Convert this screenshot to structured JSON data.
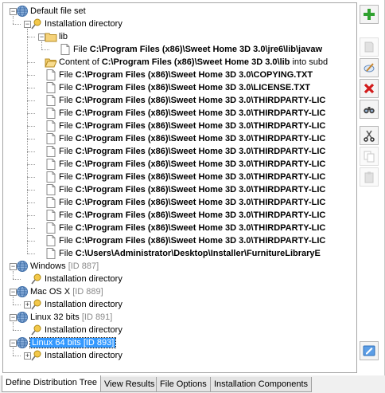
{
  "tree": {
    "rows": [
      {
        "id": "default-file-set",
        "level": 0,
        "toggle": "−",
        "icon": "globe-icon",
        "label": "Default file set",
        "label_bold": "",
        "label_suffix": "",
        "gray": "",
        "selected": false
      },
      {
        "id": "default-install-dir",
        "level": 1,
        "toggle": "−",
        "icon": "pin-icon",
        "label": "Installation directory",
        "label_bold": "",
        "label_suffix": "",
        "gray": "",
        "selected": false
      },
      {
        "id": "lib-folder",
        "level": 2,
        "toggle": "−",
        "icon": "folder-icon",
        "label": "lib",
        "label_bold": "",
        "label_suffix": "",
        "gray": "",
        "selected": false
      },
      {
        "id": "file-javaw",
        "level": 3,
        "toggle": "",
        "icon": "file-icon",
        "label": "File ",
        "label_bold": "C:\\Program Files (x86)\\Sweet Home 3D 3.0\\jre6\\lib\\javaw",
        "label_suffix": "",
        "gray": "",
        "selected": false
      },
      {
        "id": "content-of-lib",
        "level": 2,
        "toggle": "",
        "icon": "folder-open-icon",
        "label": "Content of ",
        "label_bold": "C:\\Program Files (x86)\\Sweet Home 3D 3.0\\lib",
        "label_suffix": " into subd",
        "gray": "",
        "selected": false
      },
      {
        "id": "file-copying",
        "level": 2,
        "toggle": "",
        "icon": "file-icon",
        "label": "File ",
        "label_bold": "C:\\Program Files (x86)\\Sweet Home 3D 3.0\\COPYING.TXT",
        "label_suffix": "",
        "gray": "",
        "selected": false
      },
      {
        "id": "file-license",
        "level": 2,
        "toggle": "",
        "icon": "file-icon",
        "label": "File ",
        "label_bold": "C:\\Program Files (x86)\\Sweet Home 3D 3.0\\LICENSE.TXT",
        "label_suffix": "",
        "gray": "",
        "selected": false
      },
      {
        "id": "file-thirdparty-1",
        "level": 2,
        "toggle": "",
        "icon": "file-icon",
        "label": "File ",
        "label_bold": "C:\\Program Files (x86)\\Sweet Home 3D 3.0\\THIRDPARTY-LIC",
        "label_suffix": "",
        "gray": "",
        "selected": false
      },
      {
        "id": "file-thirdparty-2",
        "level": 2,
        "toggle": "",
        "icon": "file-icon",
        "label": "File ",
        "label_bold": "C:\\Program Files (x86)\\Sweet Home 3D 3.0\\THIRDPARTY-LIC",
        "label_suffix": "",
        "gray": "",
        "selected": false
      },
      {
        "id": "file-thirdparty-3",
        "level": 2,
        "toggle": "",
        "icon": "file-icon",
        "label": "File ",
        "label_bold": "C:\\Program Files (x86)\\Sweet Home 3D 3.0\\THIRDPARTY-LIC",
        "label_suffix": "",
        "gray": "",
        "selected": false
      },
      {
        "id": "file-thirdparty-4",
        "level": 2,
        "toggle": "",
        "icon": "file-icon",
        "label": "File ",
        "label_bold": "C:\\Program Files (x86)\\Sweet Home 3D 3.0\\THIRDPARTY-LIC",
        "label_suffix": "",
        "gray": "",
        "selected": false
      },
      {
        "id": "file-thirdparty-5",
        "level": 2,
        "toggle": "",
        "icon": "file-icon",
        "label": "File ",
        "label_bold": "C:\\Program Files (x86)\\Sweet Home 3D 3.0\\THIRDPARTY-LIC",
        "label_suffix": "",
        "gray": "",
        "selected": false
      },
      {
        "id": "file-thirdparty-6",
        "level": 2,
        "toggle": "",
        "icon": "file-icon",
        "label": "File ",
        "label_bold": "C:\\Program Files (x86)\\Sweet Home 3D 3.0\\THIRDPARTY-LIC",
        "label_suffix": "",
        "gray": "",
        "selected": false
      },
      {
        "id": "file-thirdparty-7",
        "level": 2,
        "toggle": "",
        "icon": "file-icon",
        "label": "File ",
        "label_bold": "C:\\Program Files (x86)\\Sweet Home 3D 3.0\\THIRDPARTY-LIC",
        "label_suffix": "",
        "gray": "",
        "selected": false
      },
      {
        "id": "file-thirdparty-8",
        "level": 2,
        "toggle": "",
        "icon": "file-icon",
        "label": "File ",
        "label_bold": "C:\\Program Files (x86)\\Sweet Home 3D 3.0\\THIRDPARTY-LIC",
        "label_suffix": "",
        "gray": "",
        "selected": false
      },
      {
        "id": "file-thirdparty-9",
        "level": 2,
        "toggle": "",
        "icon": "file-icon",
        "label": "File ",
        "label_bold": "C:\\Program Files (x86)\\Sweet Home 3D 3.0\\THIRDPARTY-LIC",
        "label_suffix": "",
        "gray": "",
        "selected": false
      },
      {
        "id": "file-thirdparty-10",
        "level": 2,
        "toggle": "",
        "icon": "file-icon",
        "label": "File ",
        "label_bold": "C:\\Program Files (x86)\\Sweet Home 3D 3.0\\THIRDPARTY-LIC",
        "label_suffix": "",
        "gray": "",
        "selected": false
      },
      {
        "id": "file-thirdparty-11",
        "level": 2,
        "toggle": "",
        "icon": "file-icon",
        "label": "File ",
        "label_bold": "C:\\Program Files (x86)\\Sweet Home 3D 3.0\\THIRDPARTY-LIC",
        "label_suffix": "",
        "gray": "",
        "selected": false
      },
      {
        "id": "file-thirdparty-12",
        "level": 2,
        "toggle": "",
        "icon": "file-icon",
        "label": "File ",
        "label_bold": "C:\\Program Files (x86)\\Sweet Home 3D 3.0\\THIRDPARTY-LIC",
        "label_suffix": "",
        "gray": "",
        "selected": false
      },
      {
        "id": "file-furniturelibrary",
        "level": 2,
        "toggle": "",
        "icon": "file-icon",
        "label": "File ",
        "label_bold": "C:\\Users\\Administrator\\Desktop\\Installer\\FurnitureLibraryE",
        "label_suffix": "",
        "gray": "",
        "selected": false
      },
      {
        "id": "windows",
        "level": 0,
        "toggle": "−",
        "icon": "globe-icon",
        "label": "Windows ",
        "label_bold": "",
        "label_suffix": "",
        "gray": "[ID 887]",
        "selected": false
      },
      {
        "id": "windows-install-dir",
        "level": 1,
        "toggle": "",
        "icon": "pin-icon",
        "label": "Installation directory",
        "label_bold": "",
        "label_suffix": "",
        "gray": "",
        "selected": false
      },
      {
        "id": "macosx",
        "level": 0,
        "toggle": "−",
        "icon": "globe-icon",
        "label": "Mac OS X ",
        "label_bold": "",
        "label_suffix": "",
        "gray": "[ID 889]",
        "selected": false
      },
      {
        "id": "macosx-install-dir",
        "level": 1,
        "toggle": "+",
        "icon": "pin-icon",
        "label": "Installation directory",
        "label_bold": "",
        "label_suffix": "",
        "gray": "",
        "selected": false
      },
      {
        "id": "linux32",
        "level": 0,
        "toggle": "−",
        "icon": "globe-icon",
        "label": "Linux 32 bits ",
        "label_bold": "",
        "label_suffix": "",
        "gray": "[ID 891]",
        "selected": false
      },
      {
        "id": "linux32-install-dir",
        "level": 1,
        "toggle": "",
        "icon": "pin-icon",
        "label": "Installation directory",
        "label_bold": "",
        "label_suffix": "",
        "gray": "",
        "selected": false
      },
      {
        "id": "linux64",
        "level": 0,
        "toggle": "−",
        "icon": "globe-icon",
        "label": "Linux 64 bits [ID 893]",
        "label_bold": "",
        "label_suffix": "",
        "gray": "",
        "selected": true
      },
      {
        "id": "linux64-install-dir",
        "level": 1,
        "toggle": "+",
        "icon": "pin-icon",
        "label": "Installation directory",
        "label_bold": "",
        "label_suffix": "",
        "gray": "",
        "selected": false
      }
    ]
  },
  "toolbar": {
    "buttons": [
      {
        "id": "add",
        "icon": "add-icon",
        "enabled": true
      },
      {
        "id": "paste-file",
        "icon": "page-icon",
        "enabled": false
      },
      {
        "id": "edit",
        "icon": "edit-icon",
        "enabled": true
      },
      {
        "id": "delete",
        "icon": "delete-icon",
        "enabled": true
      },
      {
        "id": "find",
        "icon": "binoculars-icon",
        "enabled": true
      },
      {
        "id": "cut",
        "icon": "scissors-icon",
        "enabled": true
      },
      {
        "id": "copy",
        "icon": "copy-icon",
        "enabled": false
      },
      {
        "id": "paste",
        "icon": "paste-icon",
        "enabled": false
      },
      {
        "id": "properties",
        "icon": "properties-icon",
        "enabled": true
      }
    ]
  },
  "tabs": [
    {
      "id": "define-distribution-tree",
      "label": "Define Distribution Tree",
      "active": true
    },
    {
      "id": "view-results",
      "label": "View Results",
      "active": false
    },
    {
      "id": "file-options",
      "label": "File Options",
      "active": false
    },
    {
      "id": "installation-components",
      "label": "Installation Components",
      "active": false
    }
  ],
  "colors": {
    "selection": "#3399ff",
    "add": "#2fa12f",
    "delete": "#d21b1b"
  }
}
